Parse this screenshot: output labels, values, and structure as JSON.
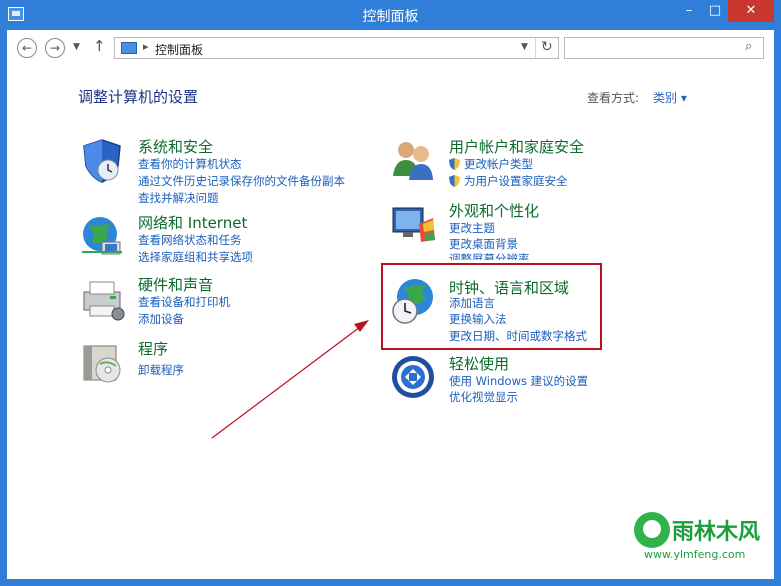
{
  "window": {
    "title": "控制面板"
  },
  "titlebar": {
    "minimize": "–",
    "maximize": "□",
    "close": "✕"
  },
  "address": {
    "crumb": "控制面板",
    "separator": "▸"
  },
  "search": {
    "placeholder": ""
  },
  "main": {
    "heading": "调整计算机的设置",
    "view_by_label": "查看方式:",
    "view_by_value": "类别 ▾"
  },
  "categories": {
    "security": {
      "title": "系统和安全",
      "links": [
        "查看你的计算机状态",
        "通过文件历史记录保存你的文件备份副本",
        "查找并解决问题"
      ],
      "icon": "shield-icon"
    },
    "network": {
      "title": "网络和 Internet",
      "links": [
        "查看网络状态和任务",
        "选择家庭组和共享选项"
      ],
      "icon": "network-globe-icon"
    },
    "hardware": {
      "title": "硬件和声音",
      "links": [
        "查看设备和打印机",
        "添加设备"
      ],
      "icon": "printer-icon"
    },
    "programs": {
      "title": "程序",
      "links": [
        "卸载程序"
      ],
      "icon": "programs-box-icon"
    },
    "accounts": {
      "title": "用户帐户和家庭安全",
      "links": [
        "更改帐户类型",
        "为用户设置家庭安全"
      ],
      "icon": "users-icon"
    },
    "appearance": {
      "title": "外观和个性化",
      "links": [
        "更改主题",
        "更改桌面背景",
        "调整屏幕分辨率"
      ],
      "icon": "monitor-palette-icon"
    },
    "clock": {
      "title": "时钟、语言和区域",
      "links": [
        "添加语言",
        "更换输入法",
        "更改日期、时间或数字格式"
      ],
      "icon": "globe-clock-icon"
    },
    "ease": {
      "title": "轻松使用",
      "links": [
        "使用 Windows 建议的设置",
        "优化视觉显示"
      ],
      "icon": "ease-of-access-icon"
    }
  },
  "watermark": {
    "brand": "雨林木风",
    "url": "www.ylmfeng.com"
  },
  "colors": {
    "titlebar": "#2f7fd8",
    "category_title": "#0c6a2c",
    "link": "#1b5fbd",
    "highlight": "#b5131d"
  }
}
